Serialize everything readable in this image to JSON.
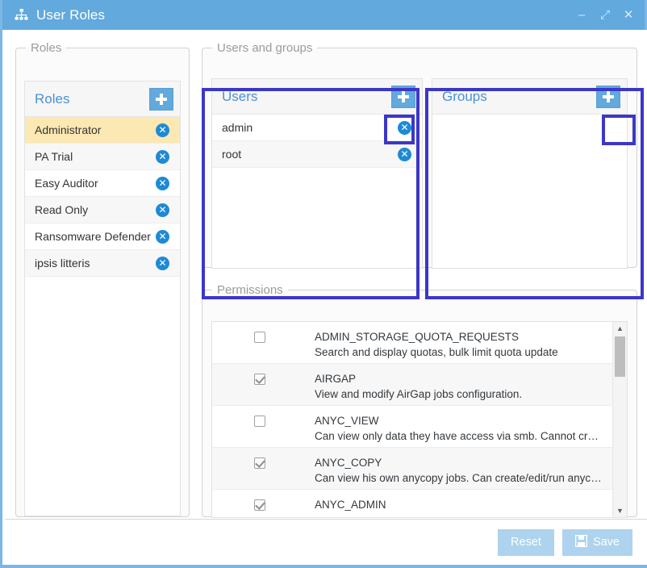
{
  "window": {
    "title": "User Roles",
    "icon": "hierarchy-icon",
    "controls": {
      "minimize": "–",
      "maximize": "⤢",
      "close": "✕"
    },
    "accent_color": "#62a9dd",
    "highlight_color": "#3b37c8"
  },
  "roles_section": {
    "legend": "Roles",
    "panel_title": "Roles",
    "add_label": "+",
    "items": [
      {
        "label": "Administrator",
        "selected": true
      },
      {
        "label": "PA Trial",
        "selected": false
      },
      {
        "label": "Easy Auditor",
        "selected": false
      },
      {
        "label": "Read Only",
        "selected": false
      },
      {
        "label": "Ransomware Defender",
        "selected": false
      },
      {
        "label": "ipsis litteris",
        "selected": false
      }
    ]
  },
  "users_groups_section": {
    "legend": "Users and groups",
    "users": {
      "panel_title": "Users",
      "add_label": "+",
      "items": [
        {
          "label": "admin"
        },
        {
          "label": "root"
        }
      ]
    },
    "groups": {
      "panel_title": "Groups",
      "add_label": "+",
      "items": []
    }
  },
  "permissions_section": {
    "legend": "Permissions",
    "rows": [
      {
        "name": "ADMIN_STORAGE_QUOTA_REQUESTS",
        "description": "Search and display quotas, bulk limit quota update",
        "checked": false
      },
      {
        "name": "AIRGAP",
        "description": "View and modify AirGap jobs configuration.",
        "checked": true
      },
      {
        "name": "ANYC_VIEW",
        "description": "Can view only data they have access via smb. Cannot create/ed…",
        "checked": false
      },
      {
        "name": "ANYC_COPY",
        "description": "Can view his own anycopy jobs. Can create/edit/run anycopy jo…",
        "checked": true
      },
      {
        "name": "ANYC_ADMIN",
        "description": "",
        "checked": true
      }
    ],
    "scrollbar": {
      "up_arrow": "▲",
      "down_arrow": "▼"
    }
  },
  "footer": {
    "reset_label": "Reset",
    "save_label": "Save",
    "save_icon": "floppy-disk-icon"
  }
}
